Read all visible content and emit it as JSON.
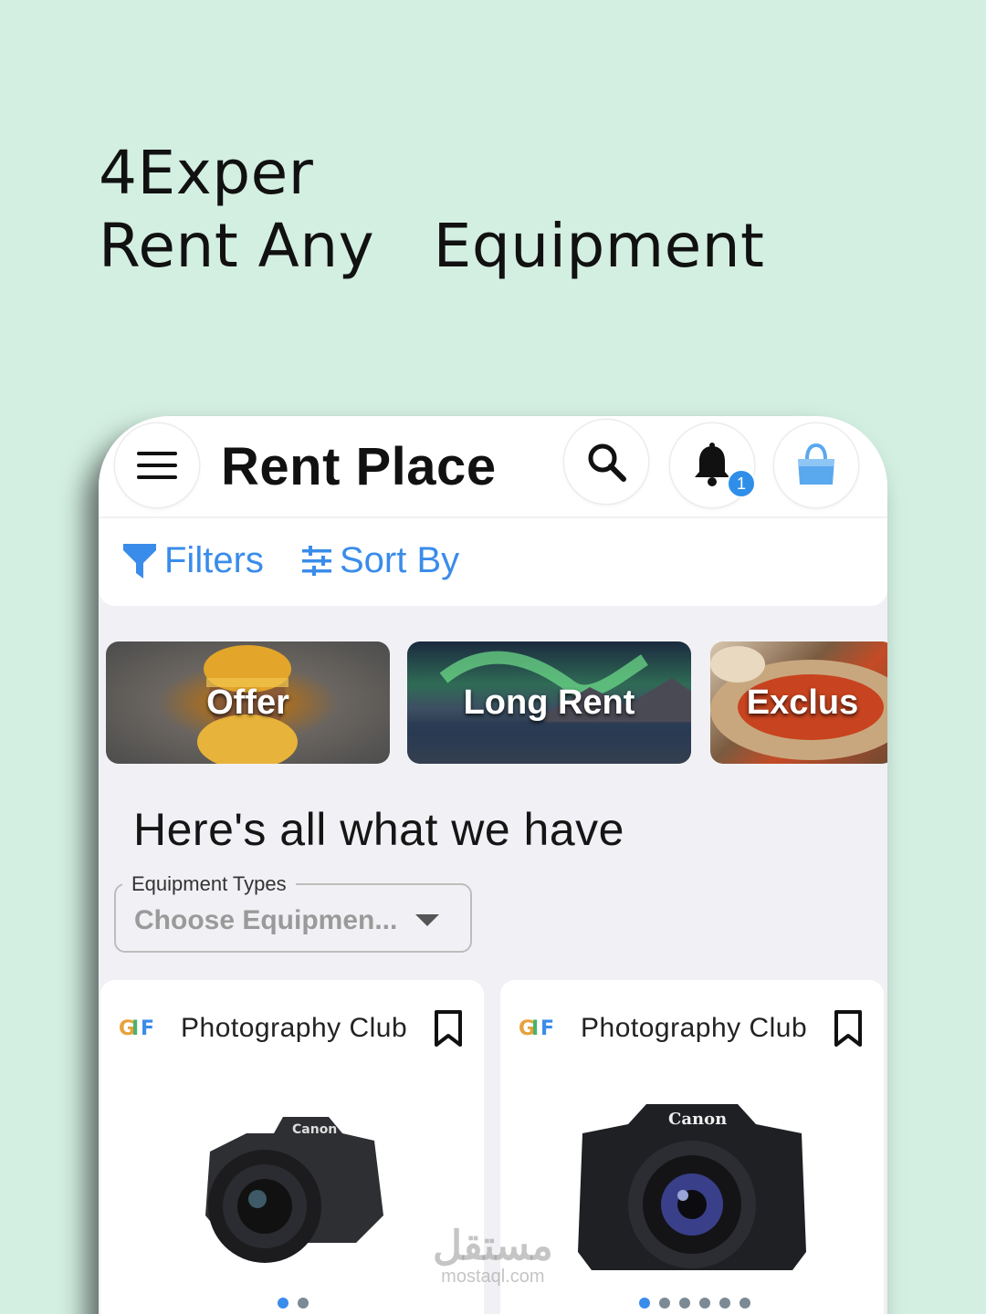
{
  "headline": {
    "line1": "4Exper",
    "line2": "Rent Any   Equipment"
  },
  "app": {
    "title": "Rent Place",
    "notification_count": "1"
  },
  "filters": {
    "filter_label": "Filters",
    "sort_label": "Sort By"
  },
  "categories": [
    {
      "label": "Offer"
    },
    {
      "label": "Long Rent"
    },
    {
      "label": "Exclus"
    }
  ],
  "section": {
    "title": "Here's all what we have"
  },
  "equipment_types": {
    "label": "Equipment Types",
    "value": "Choose Equipmen..."
  },
  "cards": [
    {
      "club": "Photography Club",
      "logo": "GIF",
      "image_dots": 2,
      "active_dot": 0
    },
    {
      "club": "Photography Club",
      "logo": "GIF",
      "image_dots": 6,
      "active_dot": 0
    }
  ],
  "camera_brand": "Canon",
  "watermark": {
    "arabic": "مستقل",
    "latin": "mostaql.com"
  },
  "colors": {
    "background": "#d3efe2",
    "accent": "#3a8cea",
    "badge": "#2f8fe8"
  }
}
